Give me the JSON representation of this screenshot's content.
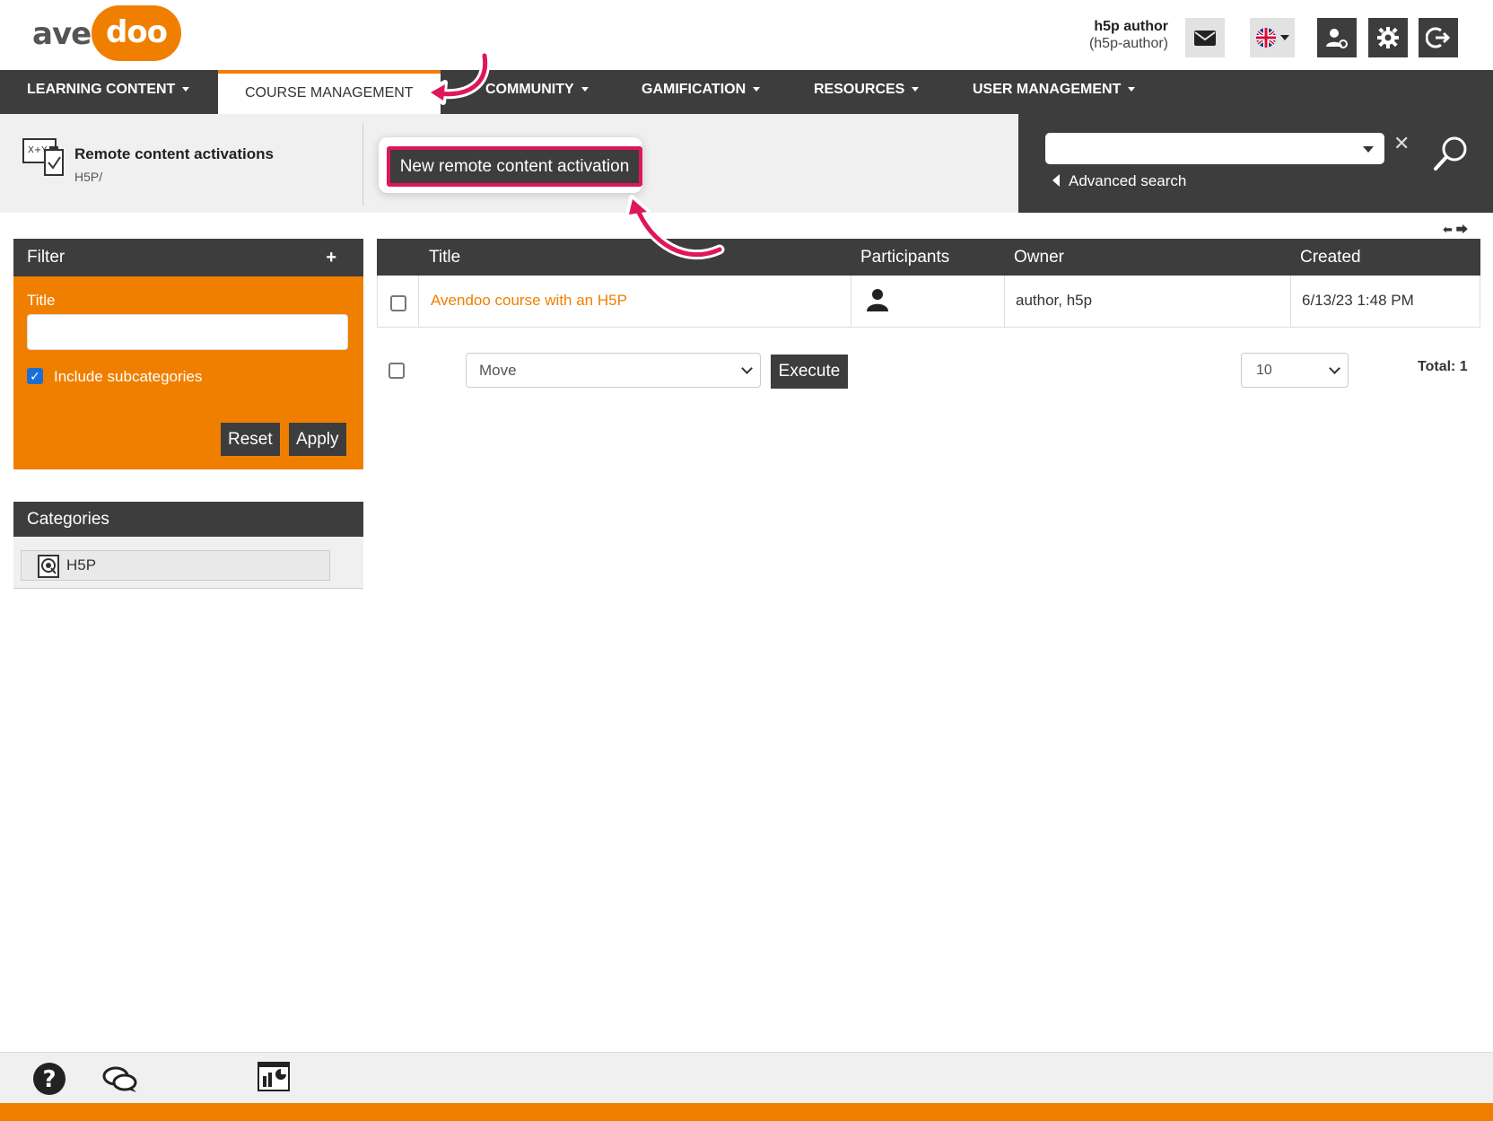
{
  "brand": {
    "logo_left": "aven",
    "logo_right": "doo",
    "accent": "#f07f00",
    "dark": "#3d3d3d",
    "highlight": "#e0165a"
  },
  "user": {
    "name": "h5p author",
    "login": "(h5p-author)"
  },
  "header_icons": [
    "mail-icon",
    "uk-flag-icon",
    "user-switch-icon",
    "gear-icon",
    "logout-icon"
  ],
  "nav": {
    "items": [
      {
        "label": "LEARNING CONTENT"
      },
      {
        "label": "COURSE MANAGEMENT"
      },
      {
        "label": "COMMUNITY"
      },
      {
        "label": "GAMIFICATION"
      },
      {
        "label": "RESOURCES"
      },
      {
        "label": "USER MANAGEMENT"
      }
    ]
  },
  "page": {
    "title": "Remote content activations",
    "path": "H5P/",
    "new_button": "New remote content activation"
  },
  "search": {
    "value": "",
    "advanced_label": "Advanced search"
  },
  "filter": {
    "header": "Filter",
    "title_label": "Title",
    "title_value": "",
    "include_subcategories_label": "Include subcategories",
    "include_subcategories_checked": true,
    "reset_label": "Reset",
    "apply_label": "Apply"
  },
  "categories": {
    "header": "Categories",
    "items": [
      {
        "label": "H5P"
      }
    ]
  },
  "table": {
    "columns": [
      "Title",
      "Participants",
      "Owner",
      "Created"
    ],
    "rows": [
      {
        "title": "Avendoo course with an H5P",
        "participants_icon": "person-icon",
        "owner": "author, h5p",
        "created": "6/13/23 1:48 PM"
      }
    ]
  },
  "bulk": {
    "action_value": "Move",
    "execute_label": "Execute",
    "page_size": "10",
    "total_label": "Total: 1"
  },
  "footer_icons": [
    "help-icon",
    "chat-icon",
    "report-icon"
  ]
}
